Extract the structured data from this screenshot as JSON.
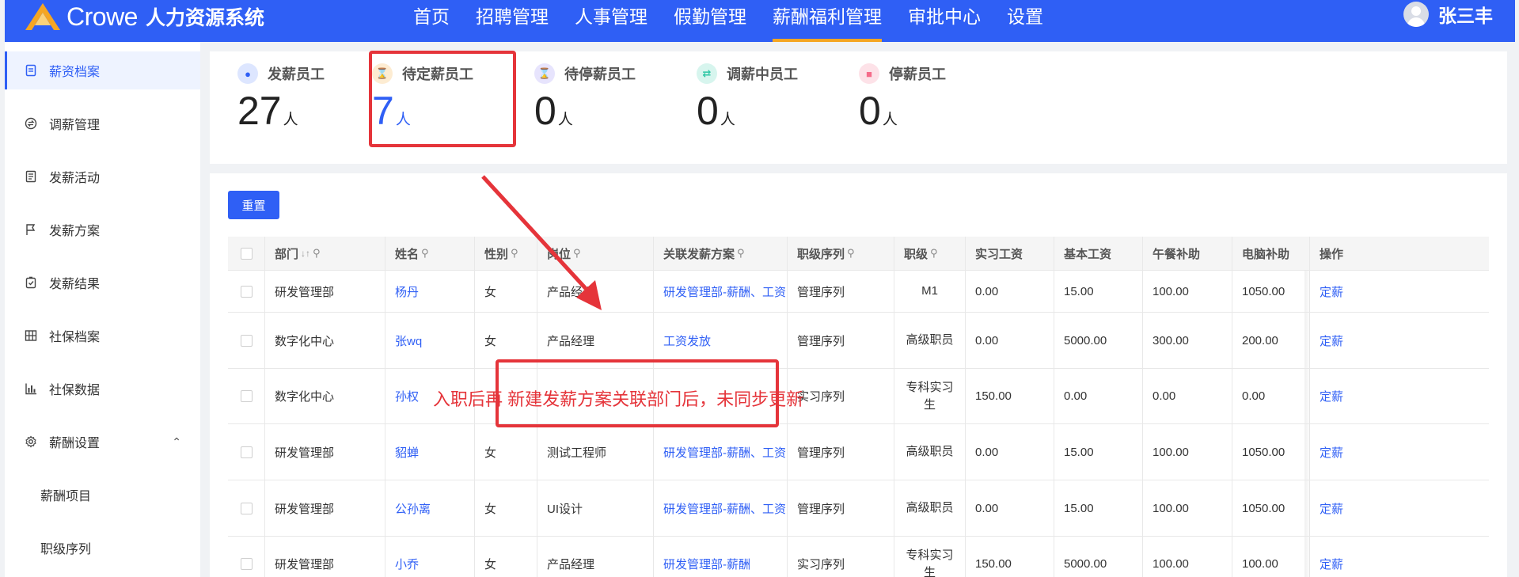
{
  "header": {
    "logo_text": "Crowe",
    "system_name": "人力资源系统",
    "nav": [
      "首页",
      "招聘管理",
      "人事管理",
      "假勤管理",
      "薪酬福利管理",
      "审批中心",
      "设置"
    ],
    "active_nav": "薪酬福利管理",
    "user_name": "张三丰"
  },
  "sidebar": {
    "items": [
      {
        "label": "薪资档案",
        "icon": "file-icon",
        "active": true
      },
      {
        "label": "调薪管理",
        "icon": "exchange-icon"
      },
      {
        "label": "发薪活动",
        "icon": "list-icon"
      },
      {
        "label": "发薪方案",
        "icon": "flag-icon"
      },
      {
        "label": "发薪结果",
        "icon": "clipboard-check-icon"
      },
      {
        "label": "社保档案",
        "icon": "grid-icon"
      },
      {
        "label": "社保数据",
        "icon": "bar-chart-icon"
      },
      {
        "label": "薪酬设置",
        "icon": "gear-icon",
        "expanded": true
      }
    ],
    "sub_items": [
      "薪酬项目",
      "职级序列"
    ]
  },
  "stats": [
    {
      "label": "发薪员工",
      "value": "27",
      "unit": "人",
      "color": "#2f5ff5",
      "icon": "money-bag-icon"
    },
    {
      "label": "待定薪员工",
      "value": "7",
      "unit": "人",
      "color": "#f5a623",
      "icon": "hourglass-icon"
    },
    {
      "label": "待停薪员工",
      "value": "0",
      "unit": "人",
      "color": "#7b6cf6",
      "icon": "hourglass-icon"
    },
    {
      "label": "调薪中员工",
      "value": "0",
      "unit": "人",
      "color": "#2ec7a5",
      "icon": "transfer-icon"
    },
    {
      "label": "停薪员工",
      "value": "0",
      "unit": "人",
      "color": "#f56c8a",
      "icon": "stop-icon"
    }
  ],
  "toolbar": {
    "reset_label": "重置"
  },
  "table": {
    "columns": [
      "部门",
      "姓名",
      "性别",
      "岗位",
      "关联发薪方案",
      "职级序列",
      "职级",
      "实习工资",
      "基本工资",
      "午餐补助",
      "电脑补助",
      "操作"
    ],
    "rows": [
      {
        "dept": "研发管理部",
        "name": "杨丹",
        "gender": "女",
        "post": "产品经理",
        "plan": "研发管理部-薪酬、工资",
        "series": "管理序列",
        "level": "M1",
        "intern": "0.00",
        "basic": "15.00",
        "lunch": "100.00",
        "pc": "1050.00",
        "op": "定薪"
      },
      {
        "dept": "数字化中心",
        "name": "张wq",
        "gender": "女",
        "post": "产品经理",
        "plan": "工资发放",
        "series": "管理序列",
        "level": "高级职员",
        "intern": "0.00",
        "basic": "5000.00",
        "lunch": "300.00",
        "pc": "200.00",
        "op": "定薪"
      },
      {
        "dept": "数字化中心",
        "name": "孙权",
        "gender": "",
        "post": "",
        "plan": "",
        "series": "实习序列",
        "level": "专科实习生",
        "intern": "150.00",
        "basic": "0.00",
        "lunch": "0.00",
        "pc": "0.00",
        "op": "定薪"
      },
      {
        "dept": "研发管理部",
        "name": "貂蝉",
        "gender": "女",
        "post": "测试工程师",
        "plan": "研发管理部-薪酬、工资",
        "series": "管理序列",
        "level": "高级职员",
        "intern": "0.00",
        "basic": "15.00",
        "lunch": "100.00",
        "pc": "1050.00",
        "op": "定薪"
      },
      {
        "dept": "研发管理部",
        "name": "公孙离",
        "gender": "女",
        "post": "UI设计",
        "plan": "研发管理部-薪酬、工资",
        "series": "管理序列",
        "level": "高级职员",
        "intern": "0.00",
        "basic": "15.00",
        "lunch": "100.00",
        "pc": "1050.00",
        "op": "定薪"
      },
      {
        "dept": "研发管理部",
        "name": "小乔",
        "gender": "女",
        "post": "产品经理",
        "plan": "研发管理部-薪酬",
        "series": "实习序列",
        "level": "专科实习生",
        "intern": "150.00",
        "basic": "5000.00",
        "lunch": "100.00",
        "pc": "100.00",
        "op": "定薪"
      }
    ]
  },
  "annotation": {
    "text": "入职后再    新建发薪方案关联部门后，未同步更新",
    "color": "#e5343a"
  }
}
